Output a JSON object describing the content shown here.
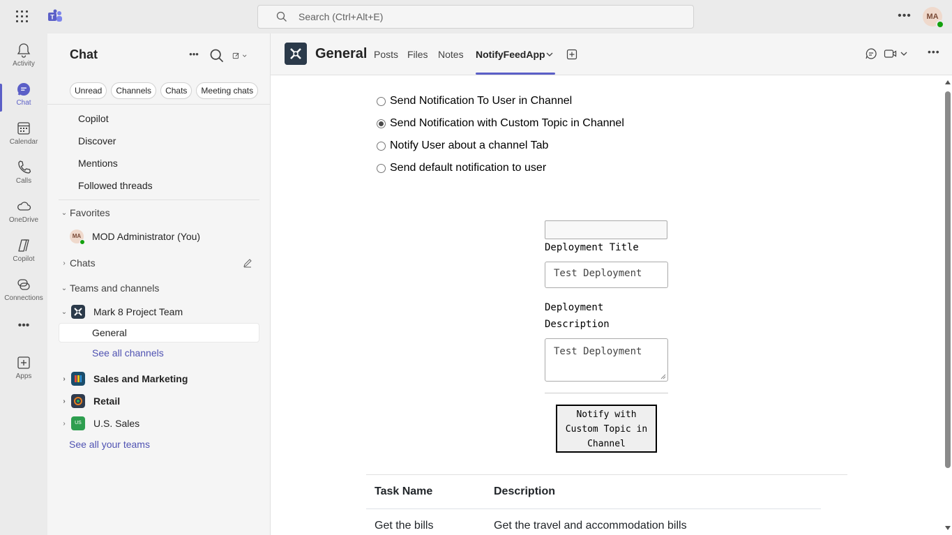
{
  "search": {
    "placeholder": "Search (Ctrl+Alt+E)"
  },
  "user": {
    "initials": "MA"
  },
  "rail": [
    {
      "label": "Activity",
      "icon": "bell-icon"
    },
    {
      "label": "Chat",
      "icon": "chat-icon",
      "active": true
    },
    {
      "label": "Calendar",
      "icon": "calendar-icon"
    },
    {
      "label": "Calls",
      "icon": "phone-icon"
    },
    {
      "label": "OneDrive",
      "icon": "cloud-icon"
    },
    {
      "label": "Copilot",
      "icon": "copilot-icon"
    },
    {
      "label": "Connections",
      "icon": "connections-icon"
    },
    {
      "label": "Apps",
      "icon": "add-apps-icon"
    }
  ],
  "chat": {
    "title": "Chat",
    "filters": [
      "Unread",
      "Channels",
      "Chats",
      "Meeting chats"
    ],
    "nav": [
      "Copilot",
      "Discover",
      "Mentions",
      "Followed threads"
    ],
    "favorites_label": "Favorites",
    "favorite_user": "MOD Administrator (You)",
    "favorite_initials": "MA",
    "chats_label": "Chats",
    "teams_label": "Teams and channels",
    "team_expanded": "Mark 8 Project Team",
    "channel_active": "General",
    "see_all_channels": "See all channels",
    "teams": [
      "Sales and Marketing",
      "Retail",
      "U.S. Sales"
    ],
    "team_us_badge": "US",
    "see_all_teams": "See all your teams"
  },
  "main": {
    "title": "General",
    "tabs": [
      "Posts",
      "Files",
      "Notes",
      "NotifyFeedApp"
    ],
    "active_tab": "NotifyFeedApp"
  },
  "form": {
    "options": [
      "Send Notification To User in Channel",
      "Send Notification with Custom Topic in Channel",
      "Notify User about a channel Tab",
      "Send default notification to user"
    ],
    "selected_index": 1,
    "title_label": "Deployment Title",
    "title_value": "Test Deployment",
    "desc_label_1": "Deployment",
    "desc_label_2": "Description",
    "desc_value": "Test Deployment",
    "button_line1": "Notify with",
    "button_line2": "Custom Topic in",
    "button_line3": "Channel"
  },
  "table": {
    "headers": [
      "Task Name",
      "Description"
    ],
    "rows": [
      [
        "Get the bills",
        "Get the travel and accommodation bills"
      ]
    ]
  },
  "colors": {
    "accent": "#5b5fc7",
    "presence": "#13a10e"
  }
}
